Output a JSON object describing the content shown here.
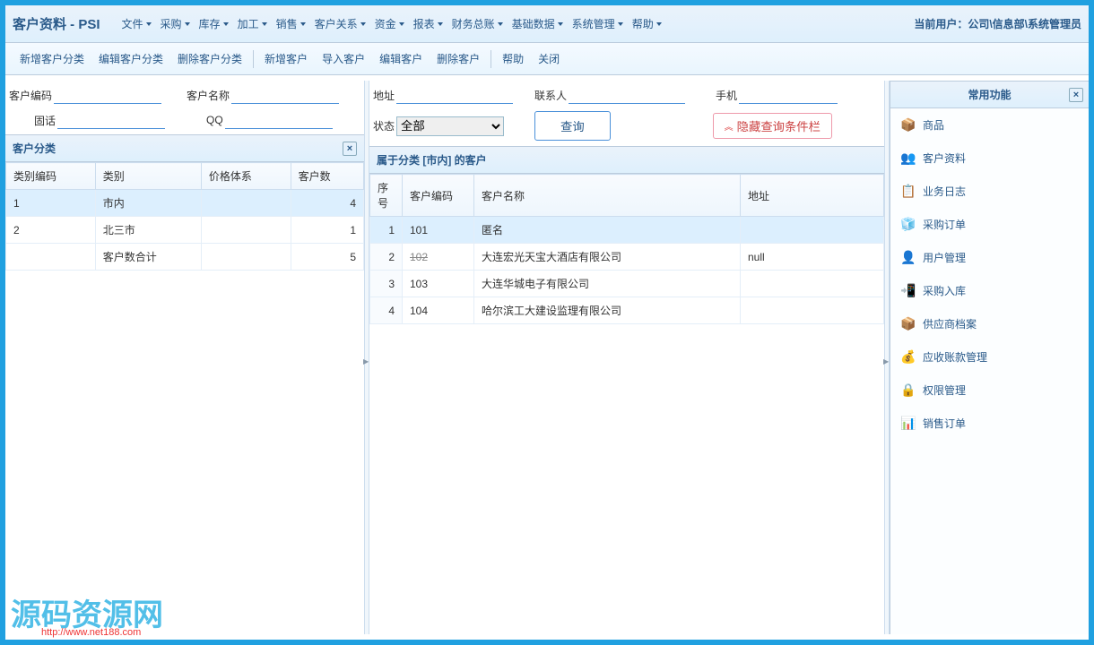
{
  "header": {
    "title": "客户资料 - PSI",
    "user_prefix": "当前用户：",
    "user": "公司\\信息部\\系统管理员",
    "menus": [
      "文件",
      "采购",
      "库存",
      "加工",
      "销售",
      "客户关系",
      "资金",
      "报表",
      "财务总账",
      "基础数据",
      "系统管理",
      "帮助"
    ]
  },
  "toolbar": {
    "items": [
      "新增客户分类",
      "编辑客户分类",
      "删除客户分类",
      "新增客户",
      "导入客户",
      "编辑客户",
      "删除客户",
      "帮助",
      "关闭"
    ],
    "separators_after": [
      2,
      6
    ]
  },
  "search": {
    "labels": {
      "code": "客户编码",
      "name": "客户名称",
      "addr": "地址",
      "contact": "联系人",
      "mobile": "手机",
      "tel": "固话",
      "qq": "QQ",
      "status": "状态"
    },
    "status_value": "全部",
    "query_btn": "查询",
    "hide_btn": "隐藏查询条件栏"
  },
  "left_panel": {
    "title": "客户分类",
    "columns": [
      "类别编码",
      "类别",
      "价格体系",
      "客户数"
    ],
    "rows": [
      {
        "code": "1",
        "name": "市内",
        "price": "",
        "count": "4",
        "sel": true
      },
      {
        "code": "2",
        "name": "北三市",
        "price": "",
        "count": "1"
      },
      {
        "code": "",
        "name": "客户数合计",
        "price": "",
        "count": "5"
      }
    ]
  },
  "mid_panel": {
    "title": "属于分类 [市内] 的客户",
    "columns": [
      "序号",
      "客户编码",
      "客户名称",
      "地址"
    ],
    "rows": [
      {
        "n": "1",
        "code": "101",
        "code_strike": false,
        "name": "匿名",
        "addr": "",
        "sel": true
      },
      {
        "n": "2",
        "code": "102",
        "code_strike": true,
        "name": "大连宏光天宝大酒店有限公司",
        "addr": "null"
      },
      {
        "n": "3",
        "code": "103",
        "code_strike": false,
        "name": "大连华城电子有限公司",
        "addr": ""
      },
      {
        "n": "4",
        "code": "104",
        "code_strike": false,
        "name": "哈尔滨工大建设监理有限公司",
        "addr": ""
      }
    ]
  },
  "right_panel": {
    "title": "常用功能",
    "items": [
      {
        "icon": "📦",
        "label": "商品"
      },
      {
        "icon": "👥",
        "label": "客户资料"
      },
      {
        "icon": "📋",
        "label": "业务日志"
      },
      {
        "icon": "🧊",
        "label": "采购订单"
      },
      {
        "icon": "👤",
        "label": "用户管理"
      },
      {
        "icon": "📲",
        "label": "采购入库"
      },
      {
        "icon": "📦",
        "label": "供应商档案"
      },
      {
        "icon": "💰",
        "label": "应收账款管理"
      },
      {
        "icon": "🔒",
        "label": "权限管理"
      },
      {
        "icon": "📊",
        "label": "销售订单"
      }
    ]
  },
  "watermark": {
    "text": "源码资源网",
    "url": "http://www.net188.com"
  }
}
